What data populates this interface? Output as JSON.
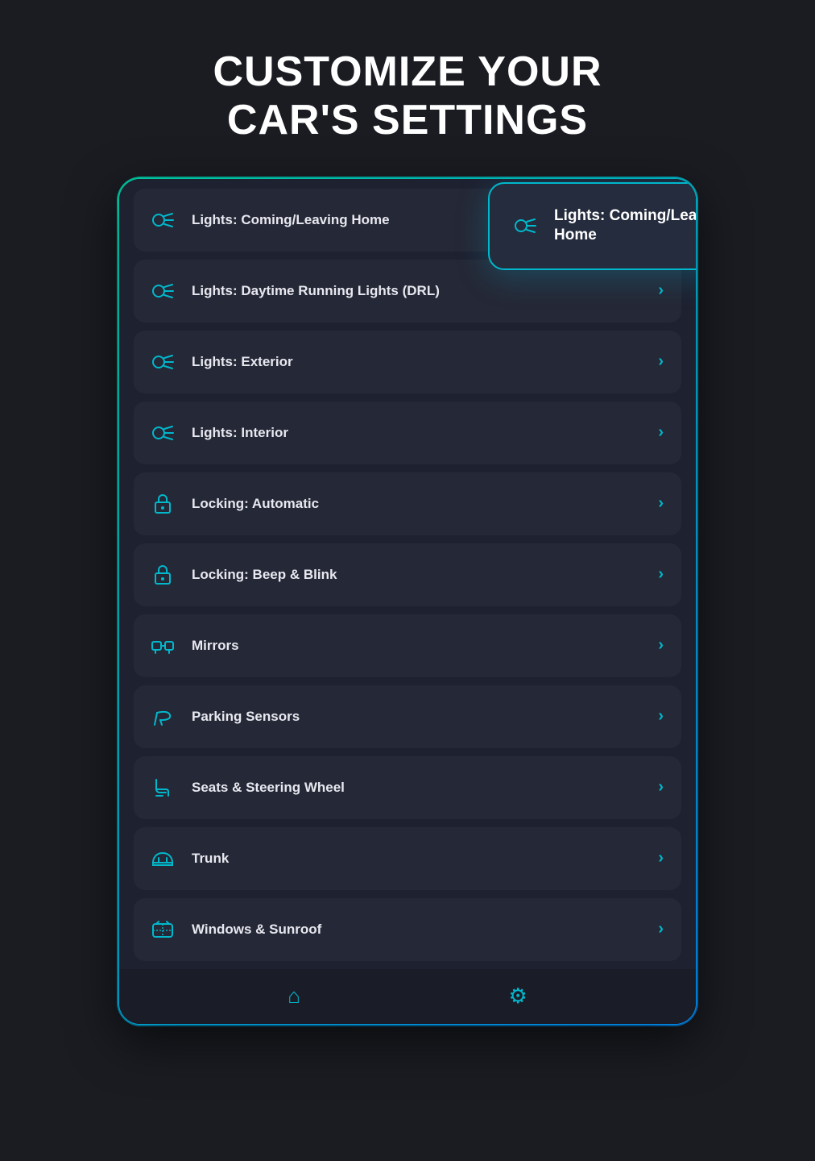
{
  "header": {
    "title_line1": "CUSTOMIZE YOUR",
    "title_line2": "CAR'S SETTINGS"
  },
  "popup": {
    "label": "Lights: Coming/Leaving\nHome",
    "chevron": "›"
  },
  "menu_items": [
    {
      "id": "lights-home",
      "label": "Lights: Coming/Leaving Home",
      "icon": "headlight",
      "chevron": "›"
    },
    {
      "id": "lights-drl",
      "label": "Lights: Daytime Running Lights (DRL)",
      "icon": "headlight",
      "chevron": "›"
    },
    {
      "id": "lights-exterior",
      "label": "Lights: Exterior",
      "icon": "headlight",
      "chevron": "›"
    },
    {
      "id": "lights-interior",
      "label": "Lights: Interior",
      "icon": "headlight",
      "chevron": "›"
    },
    {
      "id": "locking-auto",
      "label": "Locking: Automatic",
      "icon": "lock",
      "chevron": "›"
    },
    {
      "id": "locking-beep",
      "label": "Locking: Beep & Blink",
      "icon": "lock",
      "chevron": "›"
    },
    {
      "id": "mirrors",
      "label": "Mirrors",
      "icon": "mirror",
      "chevron": "›"
    },
    {
      "id": "parking",
      "label": "Parking Sensors",
      "icon": "parking",
      "chevron": "›"
    },
    {
      "id": "seats",
      "label": "Seats & Steering Wheel",
      "icon": "seat",
      "chevron": "›"
    },
    {
      "id": "trunk",
      "label": "Trunk",
      "icon": "trunk",
      "chevron": "›"
    },
    {
      "id": "windows",
      "label": "Windows & Sunroof",
      "icon": "window",
      "chevron": "›"
    }
  ],
  "bottom_bar": {
    "home_icon": "⌂",
    "settings_icon": "⚙"
  }
}
